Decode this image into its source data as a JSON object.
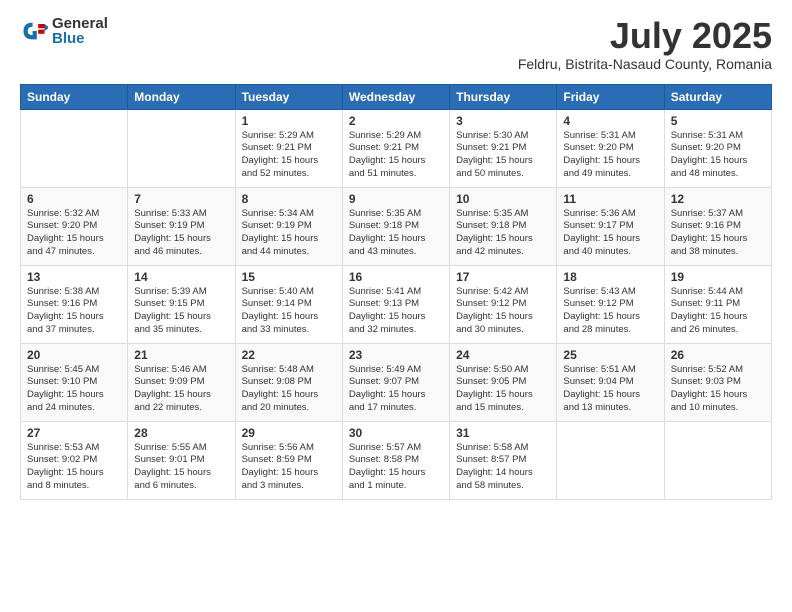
{
  "logo": {
    "general": "General",
    "blue": "Blue"
  },
  "header": {
    "month": "July 2025",
    "location": "Feldru, Bistrita-Nasaud County, Romania"
  },
  "weekdays": [
    "Sunday",
    "Monday",
    "Tuesday",
    "Wednesday",
    "Thursday",
    "Friday",
    "Saturday"
  ],
  "weeks": [
    [
      {
        "day": "",
        "info": ""
      },
      {
        "day": "",
        "info": ""
      },
      {
        "day": "1",
        "info": "Sunrise: 5:29 AM\nSunset: 9:21 PM\nDaylight: 15 hours\nand 52 minutes."
      },
      {
        "day": "2",
        "info": "Sunrise: 5:29 AM\nSunset: 9:21 PM\nDaylight: 15 hours\nand 51 minutes."
      },
      {
        "day": "3",
        "info": "Sunrise: 5:30 AM\nSunset: 9:21 PM\nDaylight: 15 hours\nand 50 minutes."
      },
      {
        "day": "4",
        "info": "Sunrise: 5:31 AM\nSunset: 9:20 PM\nDaylight: 15 hours\nand 49 minutes."
      },
      {
        "day": "5",
        "info": "Sunrise: 5:31 AM\nSunset: 9:20 PM\nDaylight: 15 hours\nand 48 minutes."
      }
    ],
    [
      {
        "day": "6",
        "info": "Sunrise: 5:32 AM\nSunset: 9:20 PM\nDaylight: 15 hours\nand 47 minutes."
      },
      {
        "day": "7",
        "info": "Sunrise: 5:33 AM\nSunset: 9:19 PM\nDaylight: 15 hours\nand 46 minutes."
      },
      {
        "day": "8",
        "info": "Sunrise: 5:34 AM\nSunset: 9:19 PM\nDaylight: 15 hours\nand 44 minutes."
      },
      {
        "day": "9",
        "info": "Sunrise: 5:35 AM\nSunset: 9:18 PM\nDaylight: 15 hours\nand 43 minutes."
      },
      {
        "day": "10",
        "info": "Sunrise: 5:35 AM\nSunset: 9:18 PM\nDaylight: 15 hours\nand 42 minutes."
      },
      {
        "day": "11",
        "info": "Sunrise: 5:36 AM\nSunset: 9:17 PM\nDaylight: 15 hours\nand 40 minutes."
      },
      {
        "day": "12",
        "info": "Sunrise: 5:37 AM\nSunset: 9:16 PM\nDaylight: 15 hours\nand 38 minutes."
      }
    ],
    [
      {
        "day": "13",
        "info": "Sunrise: 5:38 AM\nSunset: 9:16 PM\nDaylight: 15 hours\nand 37 minutes."
      },
      {
        "day": "14",
        "info": "Sunrise: 5:39 AM\nSunset: 9:15 PM\nDaylight: 15 hours\nand 35 minutes."
      },
      {
        "day": "15",
        "info": "Sunrise: 5:40 AM\nSunset: 9:14 PM\nDaylight: 15 hours\nand 33 minutes."
      },
      {
        "day": "16",
        "info": "Sunrise: 5:41 AM\nSunset: 9:13 PM\nDaylight: 15 hours\nand 32 minutes."
      },
      {
        "day": "17",
        "info": "Sunrise: 5:42 AM\nSunset: 9:12 PM\nDaylight: 15 hours\nand 30 minutes."
      },
      {
        "day": "18",
        "info": "Sunrise: 5:43 AM\nSunset: 9:12 PM\nDaylight: 15 hours\nand 28 minutes."
      },
      {
        "day": "19",
        "info": "Sunrise: 5:44 AM\nSunset: 9:11 PM\nDaylight: 15 hours\nand 26 minutes."
      }
    ],
    [
      {
        "day": "20",
        "info": "Sunrise: 5:45 AM\nSunset: 9:10 PM\nDaylight: 15 hours\nand 24 minutes."
      },
      {
        "day": "21",
        "info": "Sunrise: 5:46 AM\nSunset: 9:09 PM\nDaylight: 15 hours\nand 22 minutes."
      },
      {
        "day": "22",
        "info": "Sunrise: 5:48 AM\nSunset: 9:08 PM\nDaylight: 15 hours\nand 20 minutes."
      },
      {
        "day": "23",
        "info": "Sunrise: 5:49 AM\nSunset: 9:07 PM\nDaylight: 15 hours\nand 17 minutes."
      },
      {
        "day": "24",
        "info": "Sunrise: 5:50 AM\nSunset: 9:05 PM\nDaylight: 15 hours\nand 15 minutes."
      },
      {
        "day": "25",
        "info": "Sunrise: 5:51 AM\nSunset: 9:04 PM\nDaylight: 15 hours\nand 13 minutes."
      },
      {
        "day": "26",
        "info": "Sunrise: 5:52 AM\nSunset: 9:03 PM\nDaylight: 15 hours\nand 10 minutes."
      }
    ],
    [
      {
        "day": "27",
        "info": "Sunrise: 5:53 AM\nSunset: 9:02 PM\nDaylight: 15 hours\nand 8 minutes."
      },
      {
        "day": "28",
        "info": "Sunrise: 5:55 AM\nSunset: 9:01 PM\nDaylight: 15 hours\nand 6 minutes."
      },
      {
        "day": "29",
        "info": "Sunrise: 5:56 AM\nSunset: 8:59 PM\nDaylight: 15 hours\nand 3 minutes."
      },
      {
        "day": "30",
        "info": "Sunrise: 5:57 AM\nSunset: 8:58 PM\nDaylight: 15 hours\nand 1 minute."
      },
      {
        "day": "31",
        "info": "Sunrise: 5:58 AM\nSunset: 8:57 PM\nDaylight: 14 hours\nand 58 minutes."
      },
      {
        "day": "",
        "info": ""
      },
      {
        "day": "",
        "info": ""
      }
    ]
  ]
}
